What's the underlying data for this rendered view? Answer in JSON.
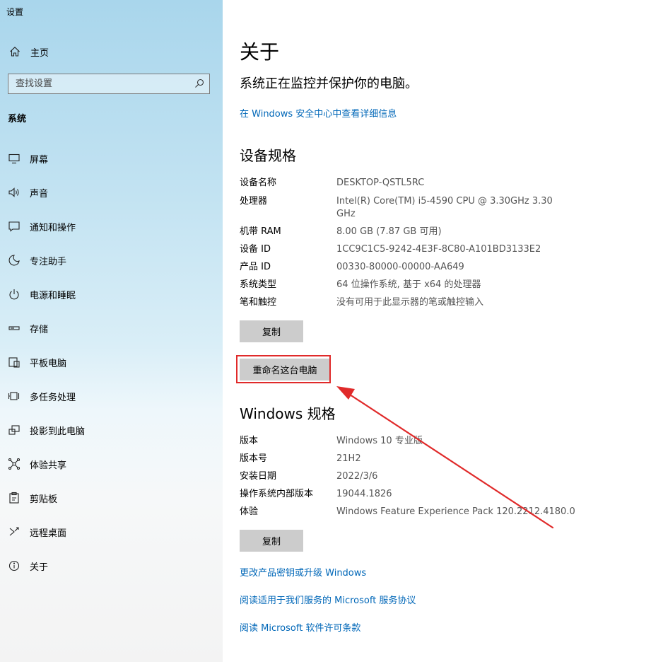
{
  "window": {
    "title": "设置"
  },
  "sidebar": {
    "home": {
      "label": "主页",
      "icon": "home-icon"
    },
    "search": {
      "placeholder": "查找设置",
      "icon": "search-icon"
    },
    "section_label": "系统",
    "items": [
      {
        "label": "屏幕",
        "icon": "display-icon"
      },
      {
        "label": "声音",
        "icon": "sound-icon"
      },
      {
        "label": "通知和操作",
        "icon": "notification-icon"
      },
      {
        "label": "专注助手",
        "icon": "moon-icon"
      },
      {
        "label": "电源和睡眠",
        "icon": "power-icon"
      },
      {
        "label": "存储",
        "icon": "storage-icon"
      },
      {
        "label": "平板电脑",
        "icon": "tablet-icon"
      },
      {
        "label": "多任务处理",
        "icon": "multitask-icon"
      },
      {
        "label": "投影到此电脑",
        "icon": "project-icon"
      },
      {
        "label": "体验共享",
        "icon": "share-icon"
      },
      {
        "label": "剪贴板",
        "icon": "clipboard-icon"
      },
      {
        "label": "远程桌面",
        "icon": "remote-desktop-icon"
      },
      {
        "label": "关于",
        "icon": "info-icon"
      }
    ]
  },
  "main": {
    "title": "关于",
    "status_text": "系统正在监控并保护你的电脑。",
    "security_link": "在 Windows 安全中心中查看详细信息",
    "device_specs": {
      "heading": "设备规格",
      "rows": [
        {
          "key": "设备名称",
          "value": "DESKTOP-QSTL5RC"
        },
        {
          "key": "处理器",
          "value": "Intel(R) Core(TM) i5-4590 CPU @ 3.30GHz   3.30 GHz"
        },
        {
          "key": "机带 RAM",
          "value": "8.00 GB (7.87 GB 可用)"
        },
        {
          "key": "设备 ID",
          "value": "1CC9C1C5-9242-4E3F-8C80-A101BD3133E2"
        },
        {
          "key": "产品 ID",
          "value": "00330-80000-00000-AA649"
        },
        {
          "key": "系统类型",
          "value": "64 位操作系统, 基于 x64 的处理器"
        },
        {
          "key": "笔和触控",
          "value": "没有可用于此显示器的笔或触控输入"
        }
      ],
      "copy_label": "复制",
      "rename_label": "重命名这台电脑"
    },
    "windows_specs": {
      "heading": "Windows 规格",
      "rows": [
        {
          "key": "版本",
          "value": "Windows 10 专业版"
        },
        {
          "key": "版本号",
          "value": "21H2"
        },
        {
          "key": "安装日期",
          "value": "2022/3/6"
        },
        {
          "key": "操作系统内部版本",
          "value": "19044.1826"
        },
        {
          "key": "体验",
          "value": "Windows Feature Experience Pack 120.2212.4180.0"
        }
      ],
      "copy_label": "复制"
    },
    "links": [
      "更改产品密钥或升级 Windows",
      "阅读适用于我们服务的 Microsoft 服务协议",
      "阅读 Microsoft 软件许可条款"
    ]
  },
  "annotation": {
    "color": "#e02a2a"
  }
}
